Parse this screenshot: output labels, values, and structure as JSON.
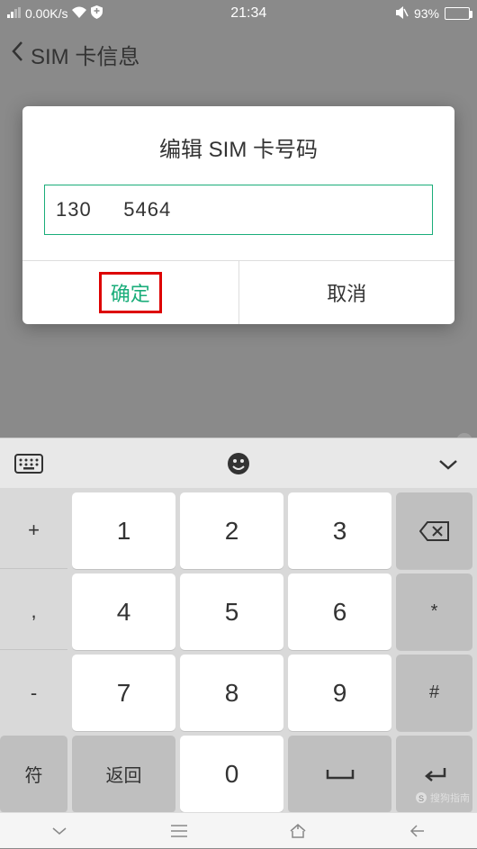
{
  "status": {
    "speed": "0.00K/s",
    "time": "21:34",
    "battery_pct": "93%"
  },
  "header": {
    "title": "SIM 卡信息"
  },
  "dialog": {
    "title": "编辑 SIM 卡号码",
    "input_value": "130     5464",
    "confirm": "确定",
    "cancel": "取消"
  },
  "keyboard": {
    "side_plus": "+",
    "side_comma": ",",
    "side_minus": "-",
    "side_paren": "(",
    "side_sym": "符",
    "k1": "1",
    "k2": "2",
    "k3": "3",
    "k4": "4",
    "k5": "5",
    "k6": "6",
    "k7": "7",
    "k8": "8",
    "k9": "9",
    "k0": "0",
    "right_star": "*",
    "right_hash": "#",
    "return": "返回"
  },
  "watermark": "搜狗指南"
}
